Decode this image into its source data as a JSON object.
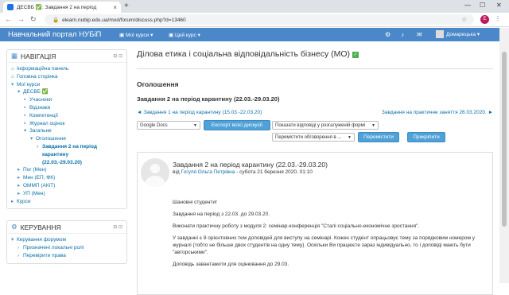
{
  "browser": {
    "tab_title": "ДЕСВБ ✅: Завдання 2 на період",
    "tab_close": "×",
    "new_tab": "+",
    "minimize": "—",
    "maximize": "☐",
    "close": "✕",
    "url": "elearn.nubip.edu.ua/mod/forum/discuss.php?d=13460",
    "profile_initial": "E"
  },
  "navbar": {
    "brand": "Навчальний портал НУБіП",
    "my_courses": "Мої курси ▾",
    "this_course": "Цей курс ▾",
    "user_name": "Домарецька ▾"
  },
  "navigation": {
    "title": "НАВІГАЦІЯ",
    "items": [
      {
        "label": "Інформаційна панель",
        "indent": 0,
        "icon": "⌂"
      },
      {
        "label": "Головна сторінка",
        "indent": 0,
        "icon": "⌂"
      },
      {
        "label": "Мої курси",
        "indent": 0,
        "icon": "▾"
      },
      {
        "label": "ДЕСВБ ✅",
        "indent": 1,
        "icon": "▾"
      },
      {
        "label": "Учасники",
        "indent": 2,
        "icon": "▪"
      },
      {
        "label": "Відзнаки",
        "indent": 2,
        "icon": "▪"
      },
      {
        "label": "Компетенції",
        "indent": 2,
        "icon": "▪"
      },
      {
        "label": "Журнал оцінок",
        "indent": 2,
        "icon": "▪"
      },
      {
        "label": "Загальне",
        "indent": 2,
        "icon": "▾"
      },
      {
        "label": "Оголошення",
        "indent": 3,
        "icon": "▾"
      },
      {
        "label": "Завдання 2 на період",
        "indent": 4,
        "icon": "›"
      },
      {
        "label": "карантину",
        "indent": 4,
        "icon": ""
      },
      {
        "label": "(22.03.-29.03.20)",
        "indent": 4,
        "icon": ""
      },
      {
        "label": "Пог (Мен)",
        "indent": 1,
        "icon": "▸"
      },
      {
        "label": "Мен (ЕП, ФК)",
        "indent": 1,
        "icon": "▸"
      },
      {
        "label": "ОММП (АКіТ)",
        "indent": 1,
        "icon": "▸"
      },
      {
        "label": "УП (Мен)",
        "indent": 1,
        "icon": "▸"
      },
      {
        "label": "Курси",
        "indent": 0,
        "icon": "▸"
      }
    ]
  },
  "admin": {
    "title": "КЕРУВАННЯ",
    "items": [
      {
        "label": "Керування форумом",
        "indent": 0,
        "icon": "▾"
      },
      {
        "label": "Призначені локальні ролі",
        "indent": 1,
        "icon": "›"
      },
      {
        "label": "Перевірити права",
        "indent": 1,
        "icon": "›"
      }
    ]
  },
  "block_controls": "⊟ ⊡",
  "course": {
    "title": "Ділова етика і соціальна відповідальність бізнесу (МО)",
    "forum": "Оголошення",
    "discussion": "Завдання 2 на період карантину (22.03.-29.03.20)",
    "prev": "◄ Завдання 1 на період карантину (15.03.-22.03.20)",
    "next": "Завдання на практичне заняття 26.03.2020. ►"
  },
  "controls": {
    "export_select": "Google Docs",
    "export_button": "Експорт всієї дискусії",
    "display_mode": "Показати відповіді у розгалуженій формі",
    "move_select": "Перемістити обговорення в ...",
    "move_button": "Перемістити",
    "pin_button": "Прикріпити"
  },
  "post": {
    "subject": "Завдання 2 на період карантину (22.03.-29.03.20)",
    "by": "від",
    "author": "Гогуля Ольга Петрівна",
    "date": " - субота 21 березня 2020, 01:10",
    "paragraphs": [
      "Шановні студенти!",
      "Завдання на період з 22.03. до 29.03.20.",
      "Виконати практичну роботу з модуля 2: семінар-конференція \"Сталі соціально-економічне зростання\".",
      "У завданні є 8 орієнтовних тем доповідей для виступу на семінарі. Кожен студент опрацьовує тему за порядковим номером у журналі (тобто не більше двох студентів на одну тему). Оскільки Ви працюєте зараз індивідуально, то і доповіді мають бути \"авторськими\".",
      "Доповідь завантажити для оцінювання до 29.03."
    ]
  }
}
